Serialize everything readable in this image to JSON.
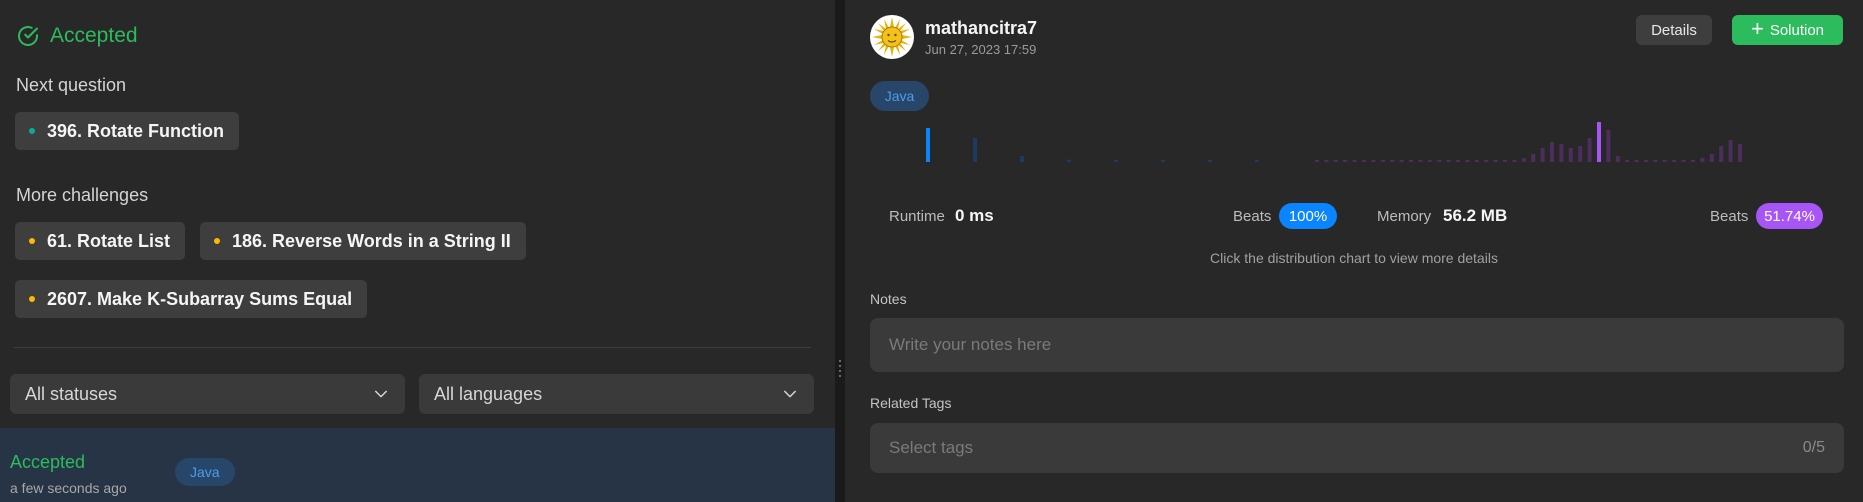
{
  "left": {
    "accepted_label": "Accepted",
    "next_question_label": "Next question",
    "next_question": {
      "title": "396. Rotate Function",
      "difficulty_color": "#00af9b"
    },
    "more_challenges_label": "More challenges",
    "challenges": [
      {
        "title": "61. Rotate List",
        "difficulty_color": "#ffb800"
      },
      {
        "title": "186. Reverse Words in a String II",
        "difficulty_color": "#ffb800"
      },
      {
        "title": "2607. Make K-Subarray Sums Equal",
        "difficulty_color": "#ffb800"
      }
    ],
    "status_filter": "All statuses",
    "language_filter": "All languages",
    "submission": {
      "status": "Accepted",
      "time": "a few seconds ago",
      "language": "Java"
    }
  },
  "right": {
    "username": "mathancitra7",
    "date": "Jun 27, 2023 17:59",
    "details_button": "Details",
    "solution_button": "Solution",
    "language": "Java",
    "runtime": {
      "label": "Runtime",
      "value": "0 ms",
      "beats_label": "Beats",
      "beats": "100%"
    },
    "memory": {
      "label": "Memory",
      "value": "56.2 MB",
      "beats_label": "Beats",
      "beats": "51.74%"
    },
    "hint": "Click the distribution chart to view more details",
    "notes_label": "Notes",
    "notes_placeholder": "Write your notes here",
    "tags_label": "Related Tags",
    "tags_placeholder": "Select tags",
    "tags_count": "0/5"
  },
  "colors": {
    "accepted": "#2cbb5d",
    "runtime_accent": "#0a84ff",
    "memory_accent": "#a855f7",
    "runtime_bar": "#1e3a5f",
    "memory_bar": "#4c2d5e"
  },
  "chart_data": {
    "type": "bar",
    "series": [
      {
        "name": "Runtime",
        "values": [
          0.85,
          0.6,
          0.15,
          0.06,
          0.05,
          0.05,
          0.05,
          0.05
        ],
        "highlight_index": 0
      },
      {
        "name": "Memory",
        "values": [
          0.05,
          0.05,
          0.05,
          0.05,
          0.05,
          0.05,
          0.05,
          0.05,
          0.05,
          0.05,
          0.05,
          0.05,
          0.05,
          0.05,
          0.05,
          0.05,
          0.05,
          0.05,
          0.05,
          0.05,
          0.05,
          0.05,
          0.1,
          0.2,
          0.35,
          0.5,
          0.45,
          0.35,
          0.4,
          0.6,
          1.0,
          0.8,
          0.15,
          0.05,
          0.05,
          0.05,
          0.05,
          0.05,
          0.05,
          0.05,
          0.05,
          0.1,
          0.2,
          0.4,
          0.55,
          0.45
        ],
        "highlight_index": 30
      }
    ]
  }
}
